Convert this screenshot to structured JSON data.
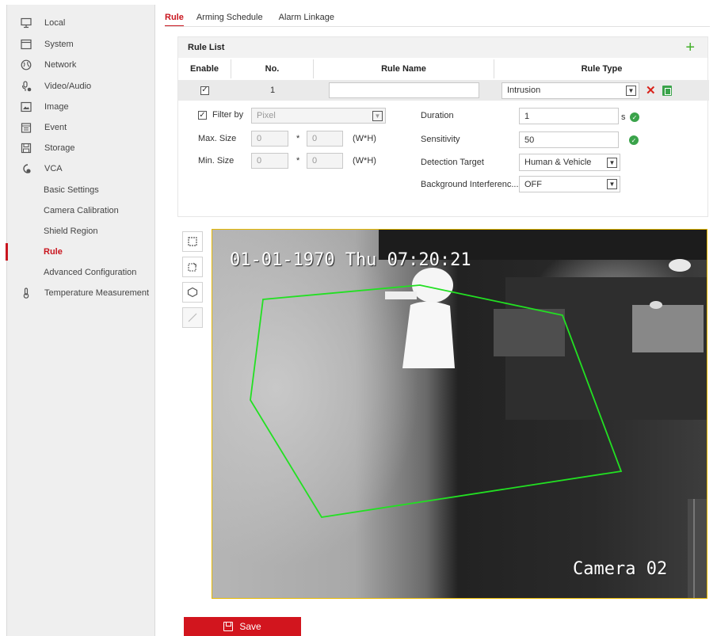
{
  "sidebar": {
    "items": [
      {
        "label": "Local",
        "icon": "monitor-icon"
      },
      {
        "label": "System",
        "icon": "system-icon"
      },
      {
        "label": "Network",
        "icon": "globe-icon"
      },
      {
        "label": "Video/Audio",
        "icon": "microphone-icon"
      },
      {
        "label": "Image",
        "icon": "image-icon"
      },
      {
        "label": "Event",
        "icon": "calendar-icon"
      },
      {
        "label": "Storage",
        "icon": "storage-icon"
      },
      {
        "label": "VCA",
        "icon": "vca-icon"
      }
    ],
    "vca_sub": [
      "Basic Settings",
      "Camera Calibration",
      "Shield Region",
      "Rule",
      "Advanced Configuration"
    ],
    "last_item": {
      "label": "Temperature Measurement",
      "icon": "thermometer-icon"
    }
  },
  "tabs": [
    "Rule",
    "Arming Schedule",
    "Alarm Linkage"
  ],
  "rule_list": {
    "title": "Rule List",
    "columns": [
      "Enable",
      "No.",
      "Rule Name",
      "Rule Type"
    ],
    "row": {
      "enabled": "✓",
      "no": "1",
      "name": "",
      "type": "Intrusion"
    }
  },
  "details": {
    "filter_by_label": "Filter by",
    "filter_by_value": "Pixel",
    "max_size_label": "Max. Size",
    "max_w": "0",
    "max_h": "0",
    "min_size_label": "Min. Size",
    "min_w": "0",
    "min_h": "0",
    "star": "*",
    "wh": "(W*H)",
    "duration_label": "Duration",
    "duration_value": "1",
    "duration_unit": "s",
    "sensitivity_label": "Sensitivity",
    "sensitivity_value": "50",
    "detection_target_label": "Detection Target",
    "detection_target_value": "Human & Vehicle",
    "background_label": "Background Interferenc...",
    "background_value": "OFF"
  },
  "video": {
    "timestamp": "01-01-1970 Thu 07:20:21",
    "camera_name": "Camera 02",
    "zone_color": "#22e022"
  },
  "save_label": "Save",
  "colors": {
    "accent": "#d2151e",
    "ok": "#3aa34a"
  }
}
